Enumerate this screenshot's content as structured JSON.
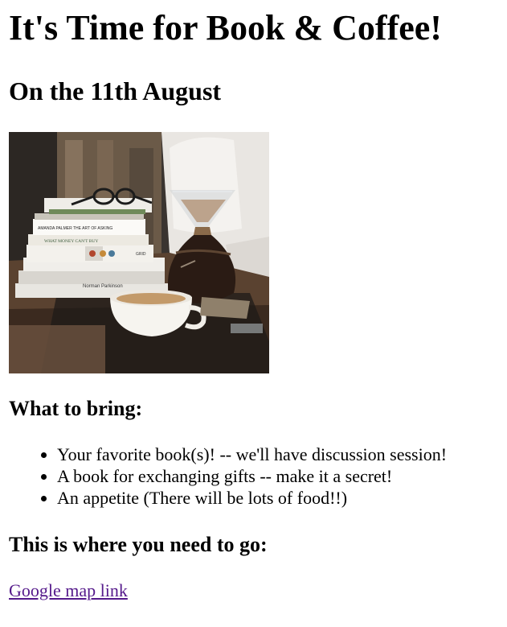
{
  "page": {
    "title": "It's Time for Book & Coffee!",
    "subtitle": "On the 11th August"
  },
  "bring": {
    "heading": "What to bring:",
    "items": [
      "Your favorite book(s)! -- we'll have discussion session!",
      "A book for exchanging gifts -- make it a secret!",
      "An appetite (There will be lots of food!!)"
    ]
  },
  "location": {
    "heading": "This is where you need to go:",
    "link_text": "Google map link"
  },
  "photo": {
    "book_spines": [
      "AMANDA PALMER   THE ART OF ASKING",
      "WHAT MONEY CAN'T BUY",
      "GRID",
      "Norman Parkinson"
    ]
  },
  "colors": {
    "link_visited": "#551a8b",
    "text": "#000000",
    "background": "#ffffff"
  }
}
